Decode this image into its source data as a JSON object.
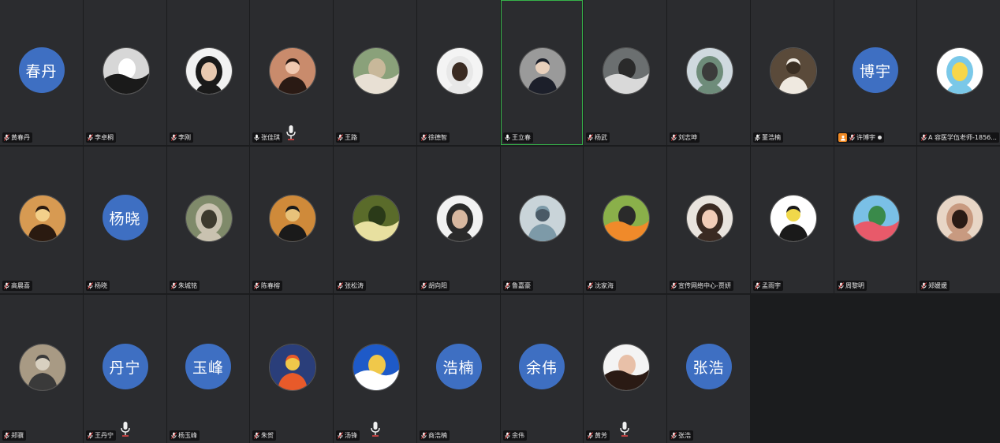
{
  "participants": [
    {
      "name": "黄春丹",
      "avatar_text": "春丹",
      "mic": "muted"
    },
    {
      "name": "李卓桐",
      "photo": {
        "bg": "#d7d7d7",
        "fg": "#1a1a1a",
        "accent": "#ffffff"
      },
      "mic": "muted"
    },
    {
      "name": "李刚",
      "photo": {
        "bg": "#f2f2f2",
        "fg": "#1a1a1a",
        "accent": "#e8c9b0"
      },
      "mic": "muted"
    },
    {
      "name": "张佳琪",
      "photo": {
        "bg": "#c98b6c",
        "fg": "#2a1a14",
        "accent": "#f0c8b0"
      },
      "mic": "on"
    },
    {
      "name": "王路",
      "photo": {
        "bg": "#8aa17a",
        "fg": "#e8e0d4",
        "accent": "#c8b89a"
      },
      "mic": "muted"
    },
    {
      "name": "徐德智",
      "photo": {
        "bg": "#f4f4f4",
        "fg": "#e8e8e8",
        "accent": "#3a2b22"
      },
      "mic": "muted"
    },
    {
      "name": "王立春",
      "photo": {
        "bg": "#9a9a9a",
        "fg": "#1c1f2a",
        "accent": "#e8d0bc"
      },
      "mic": "on",
      "speaking": true
    },
    {
      "name": "杨武",
      "photo": {
        "bg": "#6b6f70",
        "fg": "#d9d9d9",
        "accent": "#2a2a2a"
      },
      "mic": "muted"
    },
    {
      "name": "刘志坤",
      "photo": {
        "bg": "#cfd9df",
        "fg": "#6e8c7a",
        "accent": "#3b3b3b"
      },
      "mic": "muted"
    },
    {
      "name": "董浩楠",
      "photo": {
        "bg": "#5a4a3a",
        "fg": "#efe9e0",
        "accent": "#3a2e22"
      },
      "mic": "off"
    },
    {
      "name": "许博宇",
      "avatar_text": "博宇",
      "mic": "muted",
      "host": true,
      "extra_dot": true
    },
    {
      "name": "A 容医学伍老师-1856...",
      "photo": {
        "bg": "#ffffff",
        "fg": "#7ac8e8",
        "accent": "#f7d64a"
      },
      "mic": "muted"
    },
    {
      "name": "高晨喜",
      "photo": {
        "bg": "#d79a52",
        "fg": "#2a1a10",
        "accent": "#f3d08a"
      },
      "mic": "muted"
    },
    {
      "name": "杨晓",
      "avatar_text": "杨晓",
      "mic": "muted"
    },
    {
      "name": "朱城铭",
      "photo": {
        "bg": "#7f8a6a",
        "fg": "#c9c2b0",
        "accent": "#3d3a2e"
      },
      "mic": "muted"
    },
    {
      "name": "陈春榕",
      "photo": {
        "bg": "#cf8a3a",
        "fg": "#1a1a1a",
        "accent": "#e8c27a"
      },
      "mic": "muted"
    },
    {
      "name": "张松涛",
      "photo": {
        "bg": "#5a6b2a",
        "fg": "#e8e0a0",
        "accent": "#2a3a18"
      },
      "mic": "muted"
    },
    {
      "name": "胡向阳",
      "photo": {
        "bg": "#f2f2f2",
        "fg": "#2a2a2a",
        "accent": "#d8b8a0"
      },
      "mic": "muted"
    },
    {
      "name": "鲁嘉豪",
      "photo": {
        "bg": "#c9d4d9",
        "fg": "#7d9aa8",
        "accent": "#4a5a66"
      },
      "mic": "muted"
    },
    {
      "name": "沈家海",
      "photo": {
        "bg": "#8ab04a",
        "fg": "#f08a2a",
        "accent": "#2a2a2a"
      },
      "mic": "muted"
    },
    {
      "name": "宣传网络中心-贾妍",
      "photo": {
        "bg": "#e9e4de",
        "fg": "#3a2a22",
        "accent": "#f2cdb8"
      },
      "mic": "muted"
    },
    {
      "name": "孟雨宇",
      "photo": {
        "bg": "#ffffff",
        "fg": "#1a1a1a",
        "accent": "#f0d84a"
      },
      "mic": "muted"
    },
    {
      "name": "周黎明",
      "photo": {
        "bg": "#7ac0e6",
        "fg": "#e85a6a",
        "accent": "#3a8a4a"
      },
      "mic": "muted"
    },
    {
      "name": "郑媛媛",
      "photo": {
        "bg": "#e8d6c6",
        "fg": "#c89a80",
        "accent": "#2a1a14"
      },
      "mic": "muted"
    },
    {
      "name": "郑骥",
      "photo": {
        "bg": "#a89a84",
        "fg": "#3a3a3a",
        "accent": "#d8d0c0"
      },
      "mic": "muted"
    },
    {
      "name": "王丹宁",
      "avatar_text": "丹宁",
      "mic": "muted"
    },
    {
      "name": "杨玉峰",
      "avatar_text": "玉峰",
      "mic": "muted"
    },
    {
      "name": "朱贺",
      "photo": {
        "bg": "#2a3e7a",
        "fg": "#e85a2a",
        "accent": "#f0c84a"
      },
      "mic": "muted"
    },
    {
      "name": "汤锋",
      "photo": {
        "bg": "#1e5ac8",
        "fg": "#ffffff",
        "accent": "#f0c84a"
      },
      "mic": "muted"
    },
    {
      "name": "商浩楠",
      "avatar_text": "浩楠",
      "mic": "muted"
    },
    {
      "name": "余伟",
      "avatar_text": "余伟",
      "mic": "muted"
    },
    {
      "name": "黄芳",
      "photo": {
        "bg": "#f4f4f4",
        "fg": "#2a1a14",
        "accent": "#e8c0a8"
      },
      "mic": "muted"
    },
    {
      "name": "张浩",
      "avatar_text": "张浩",
      "mic": "muted"
    }
  ],
  "colors": {
    "tile_bg": "#2b2c2f",
    "text_avatar_bg": "#3e6fc2",
    "speaking_border": "#36b34a",
    "mic_muted": "#e04545",
    "mic_on": "#ffffff",
    "host_badge": "#f08a24"
  },
  "icons": {
    "mic_muted": "mic-muted-icon",
    "mic_on": "mic-icon",
    "host": "host-icon",
    "speaker_overlay": "speaking-mic-icon"
  }
}
